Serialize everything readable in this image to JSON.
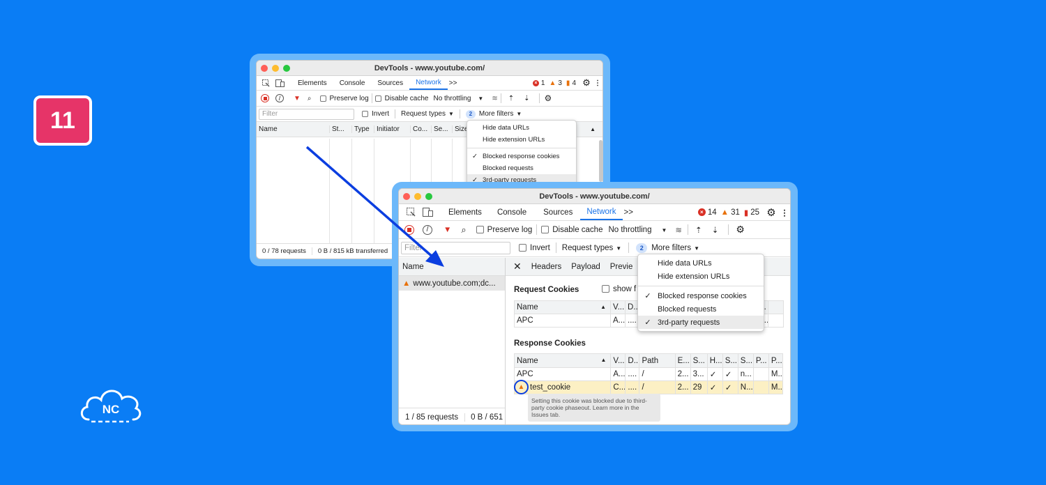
{
  "badge_number": "11",
  "logo_text": "NC",
  "colors": {
    "background": "#0a7df5",
    "badge": "#e63468",
    "accent": "#1a73e8",
    "arrow": "#0b3ee0"
  },
  "back": {
    "title": "DevTools - www.youtube.com/",
    "tabs": [
      "Elements",
      "Console",
      "Sources",
      "Network"
    ],
    "active_tab": "Network",
    "counts": {
      "errors": "1",
      "warnings": "3",
      "issues": "4"
    },
    "toolbar": {
      "preserve_log": "Preserve log",
      "disable_cache": "Disable cache",
      "throttling": "No throttling"
    },
    "filter_placeholder": "Filter",
    "invert": "Invert",
    "request_types": "Request types",
    "more_filters_count": "2",
    "more_filters": "More filters",
    "columns": [
      "Name",
      "St...",
      "Type",
      "Initiator",
      "Co...",
      "Se...",
      "Size"
    ],
    "status": {
      "requests": "0 / 78 requests",
      "transferred": "0 B / 815 kB transferred"
    },
    "menu": [
      {
        "label": "Hide data URLs",
        "checked": false
      },
      {
        "label": "Hide extension URLs",
        "checked": false
      },
      {
        "label": "Blocked response cookies",
        "checked": true
      },
      {
        "label": "Blocked requests",
        "checked": false
      },
      {
        "label": "3rd-party requests",
        "checked": true
      }
    ]
  },
  "front": {
    "title": "DevTools - www.youtube.com/",
    "tabs": [
      "Elements",
      "Console",
      "Sources",
      "Network"
    ],
    "active_tab": "Network",
    "counts": {
      "errors": "14",
      "warnings": "31",
      "issues": "25"
    },
    "toolbar": {
      "preserve_log": "Preserve log",
      "disable_cache": "Disable cache",
      "throttling": "No throttling"
    },
    "filter_placeholder": "Filter",
    "invert": "Invert",
    "request_types": "Request types",
    "more_filters_count": "2",
    "more_filters": "More filters",
    "name_header": "Name",
    "request_row": "www.youtube.com;dc...",
    "detail_tabs": [
      "Headers",
      "Payload",
      "Previe"
    ],
    "request_cookies_title": "Request Cookies",
    "show_filtered": "show f",
    "req_table": {
      "headers": [
        "Name",
        "V...",
        "D...",
        "",
        "",
        "",
        "",
        "",
        "P..."
      ],
      "rows": [
        [
          "APC",
          "A...",
          "....",
          "",
          "",
          "",
          "",
          "",
          "M..."
        ]
      ]
    },
    "response_cookies_title": "Response Cookies",
    "resp_table": {
      "headers": [
        "Name",
        "V...",
        "D...",
        "Path",
        "E...",
        "S...",
        "H...",
        "S...",
        "S...",
        "P...",
        "P..."
      ],
      "rows": [
        [
          "APC",
          "A...",
          "....",
          "/",
          "2...",
          "3...",
          "✓",
          "✓",
          "n...",
          "",
          "M..."
        ],
        [
          "test_cookie",
          "C...",
          "....",
          "/",
          "2...",
          "29",
          "✓",
          "✓",
          "N...",
          "",
          "M..."
        ]
      ]
    },
    "tooltip": "Setting this cookie was blocked due to third-party cookie phaseout. Learn more in the Issues tab.",
    "status": {
      "requests": "1 / 85 requests",
      "transferred": "0 B / 651"
    },
    "menu": [
      {
        "label": "Hide data URLs",
        "checked": false
      },
      {
        "label": "Hide extension URLs",
        "checked": false
      },
      {
        "label": "Blocked response cookies",
        "checked": true
      },
      {
        "label": "Blocked requests",
        "checked": false
      },
      {
        "label": "3rd-party requests",
        "checked": true
      }
    ]
  }
}
